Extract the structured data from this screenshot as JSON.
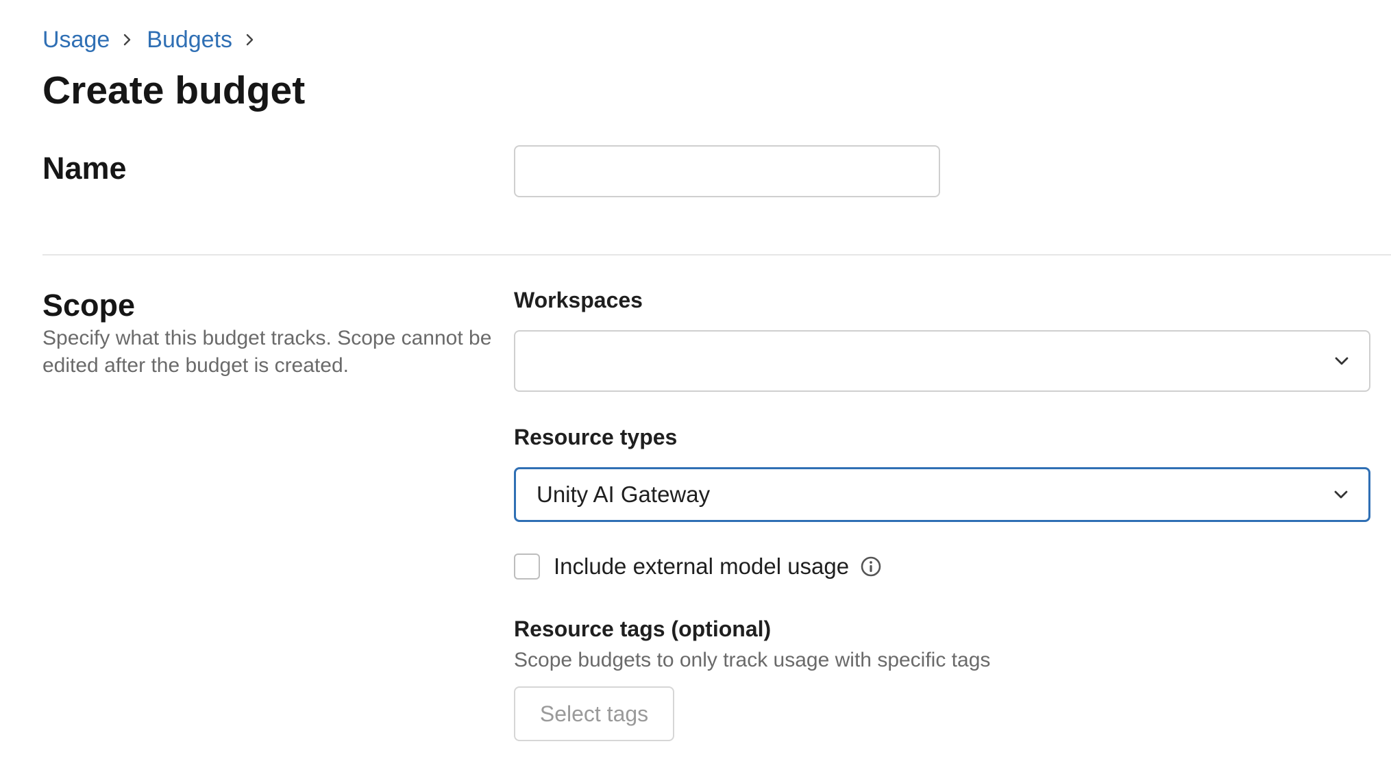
{
  "breadcrumb": {
    "items": [
      {
        "label": "Usage"
      },
      {
        "label": "Budgets"
      }
    ]
  },
  "page": {
    "title": "Create budget"
  },
  "name_section": {
    "label": "Name",
    "input_value": "",
    "input_placeholder": ""
  },
  "scope_section": {
    "label": "Scope",
    "description": "Specify what this budget tracks. Scope cannot be edited after the budget is created.",
    "workspaces": {
      "label": "Workspaces",
      "selected_value": ""
    },
    "resource_types": {
      "label": "Resource types",
      "selected_value": "Unity AI Gateway",
      "focused": true
    },
    "external_usage": {
      "label": "Include external model usage",
      "checked": false
    },
    "resource_tags": {
      "label": "Resource tags (optional)",
      "description": "Scope budgets to only track usage with specific tags",
      "button_label": "Select tags"
    }
  },
  "icons": {
    "breadcrumb_separator": "chevron-right-icon",
    "dropdown": "chevron-down-icon",
    "info": "info-icon"
  },
  "colors": {
    "link": "#2f6fb4",
    "focus_border": "#2f6fb4",
    "muted_text": "#6a6a6a"
  }
}
